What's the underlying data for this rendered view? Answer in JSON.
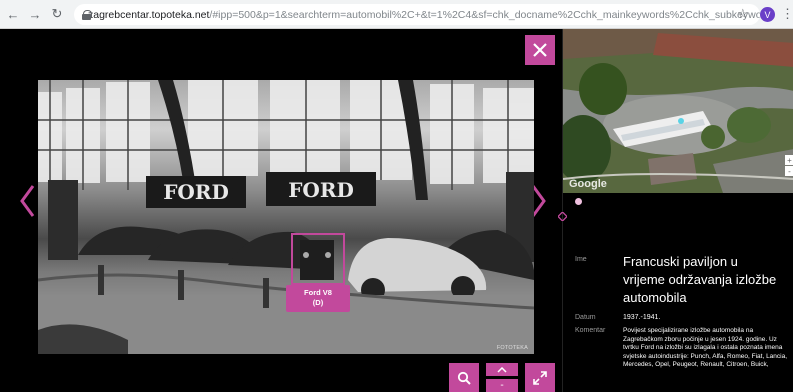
{
  "browser": {
    "url_host": "zagrebcentar.topoteka.net",
    "url_path": "/#ipp=500&p=1&searchterm=automobil%2C+&t=1%2C4&sf=chk_docname%2Cchk_mainkeywords%2Cchk_subkeywords&sort=publish...",
    "avatar_letter": "V"
  },
  "viewer": {
    "hotspot_label_line1": "Ford V8",
    "hotspot_label_line2": "(D)",
    "sign_left": "FORD",
    "sign_right": "FORD",
    "photo_credit": "FOTOTEKA",
    "control_minus": "-"
  },
  "map": {
    "brand": "Google",
    "zoom_in": "+",
    "zoom_out": "-"
  },
  "details": {
    "name_label": "Ime",
    "name_value": "Francuski paviljon u vrijeme održavanja izložbe automobila",
    "date_label": "Datum",
    "date_value": "1937.-1941.",
    "comment_label": "Komentar",
    "comment_value": "Povijest specijalizirane izložbe automobila na Zagrebačkom zboru počinje u jesen 1924. godine. Uz tvrtku Ford na izložbi su izlagala i ostala poznata imena svjetske autoindustrije: Punch, Alfa, Romeo, Fiat, Lancia, Mercedes, Opel, Peugeot, Renault, Citroen, Buick,"
  },
  "colors": {
    "accent": "#c2499c",
    "background": "#000000"
  }
}
